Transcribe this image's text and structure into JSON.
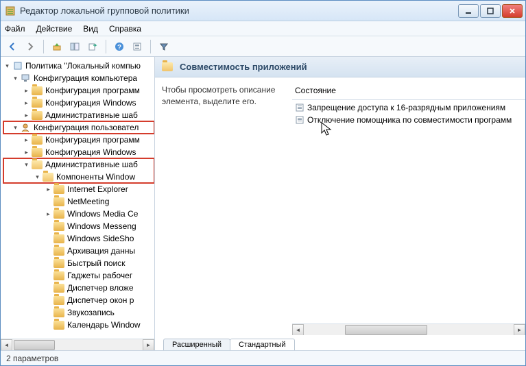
{
  "window": {
    "title": "Редактор локальной групповой политики"
  },
  "menu": {
    "file": "Файл",
    "action": "Действие",
    "view": "Вид",
    "help": "Справка"
  },
  "tree": {
    "root": "Политика \"Локальный компью",
    "computer_config": "Конфигурация компьютера",
    "software_config": "Конфигурация программ",
    "windows_config": "Конфигурация Windows",
    "admin_templates": "Административные шаб",
    "user_config": "Конфигурация пользовател",
    "windows_components": "Компоненты Window",
    "ie": "Internet Explorer",
    "netmeeting": "NetMeeting",
    "wmc": "Windows Media Ce",
    "wmsg": "Windows Messeng",
    "sideshow": "Windows SideSho",
    "archive": "Архивация данны",
    "search": "Быстрый поиск",
    "gadgets": "Гаджеты рабочег",
    "attach": "Диспетчер вложе",
    "deskmgr": "Диспетчер окон р",
    "sound": "Звукозапись",
    "calendar": "Календарь Window"
  },
  "detail": {
    "header": "Совместимость приложений",
    "desc": "Чтобы просмотреть описание элемента, выделите его.",
    "column": "Состояние",
    "items": [
      "Запрещение доступа к 16-разрядным приложениям",
      "Отключение помощника по совместимости программ"
    ]
  },
  "tabs": {
    "extended": "Расширенный",
    "standard": "Стандартный"
  },
  "status": "2 параметров"
}
